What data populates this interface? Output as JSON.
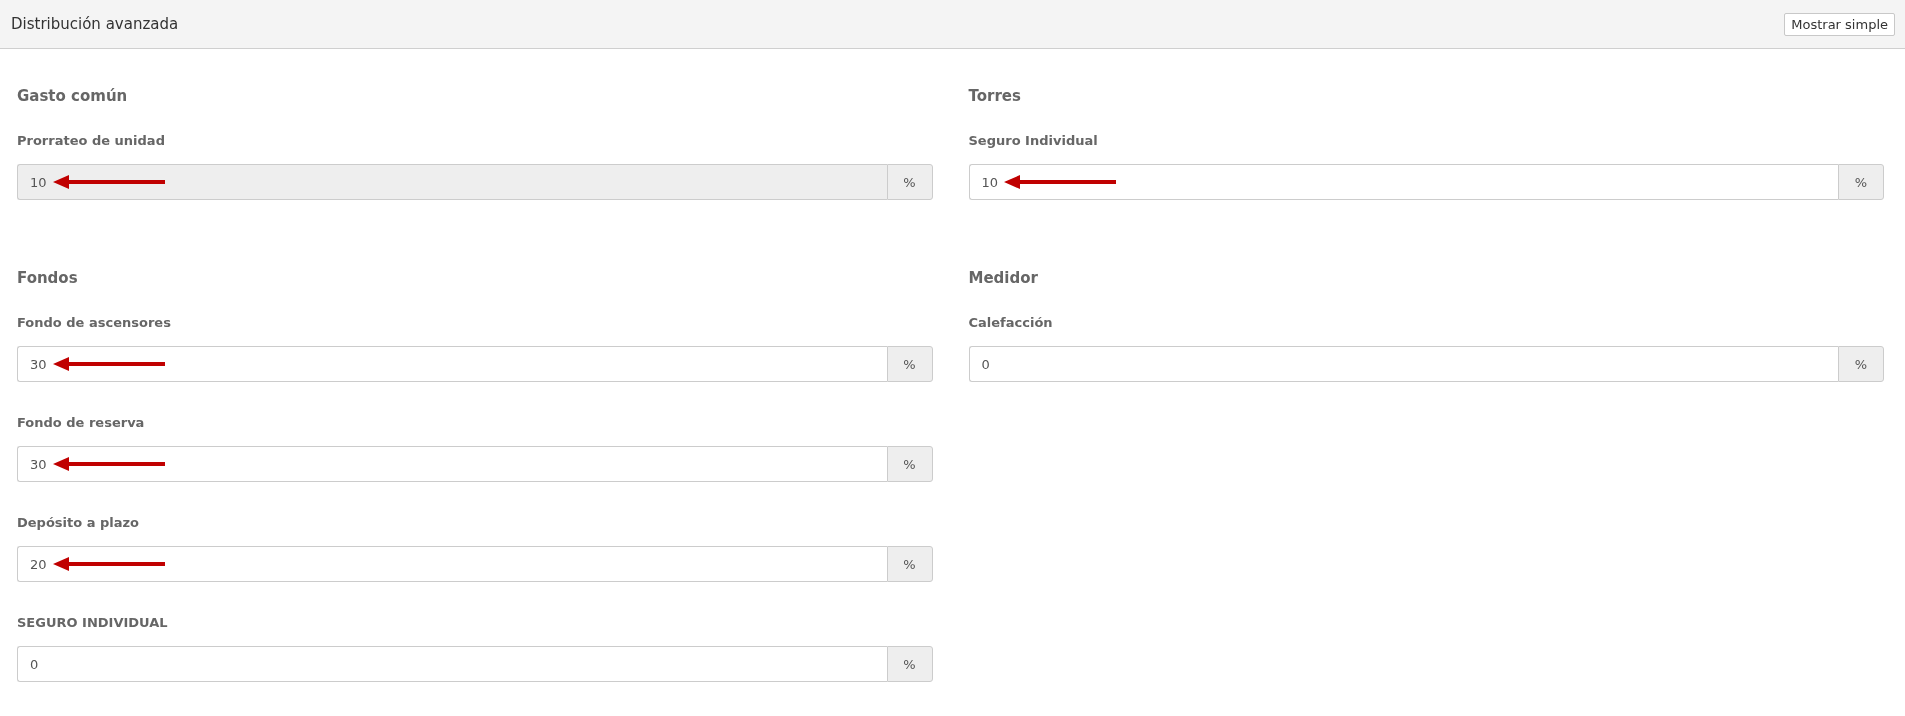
{
  "header": {
    "title": "Distribución avanzada",
    "button": "Mostrar simple"
  },
  "sections": [
    {
      "title": "Gasto común",
      "fields": [
        {
          "label": "Prorrateo de unidad",
          "value": "10",
          "unit": "%",
          "disabled": true,
          "highlighted": true
        }
      ]
    },
    {
      "title": "Torres",
      "fields": [
        {
          "label": "Seguro Individual",
          "value": "10",
          "unit": "%",
          "disabled": false,
          "highlighted": true
        }
      ]
    },
    {
      "title": "Fondos",
      "fields": [
        {
          "label": "Fondo de ascensores",
          "value": "30",
          "unit": "%",
          "disabled": false,
          "highlighted": true
        },
        {
          "label": "Fondo de reserva",
          "value": "30",
          "unit": "%",
          "disabled": false,
          "highlighted": true
        },
        {
          "label": "Depósito a plazo",
          "value": "20",
          "unit": "%",
          "disabled": false,
          "highlighted": true
        },
        {
          "label": "SEGURO INDIVIDUAL",
          "value": "0",
          "unit": "%",
          "disabled": false,
          "highlighted": false
        }
      ]
    },
    {
      "title": "Medidor",
      "fields": [
        {
          "label": "Calefacción",
          "value": "0",
          "unit": "%",
          "disabled": false,
          "highlighted": false
        }
      ]
    }
  ]
}
